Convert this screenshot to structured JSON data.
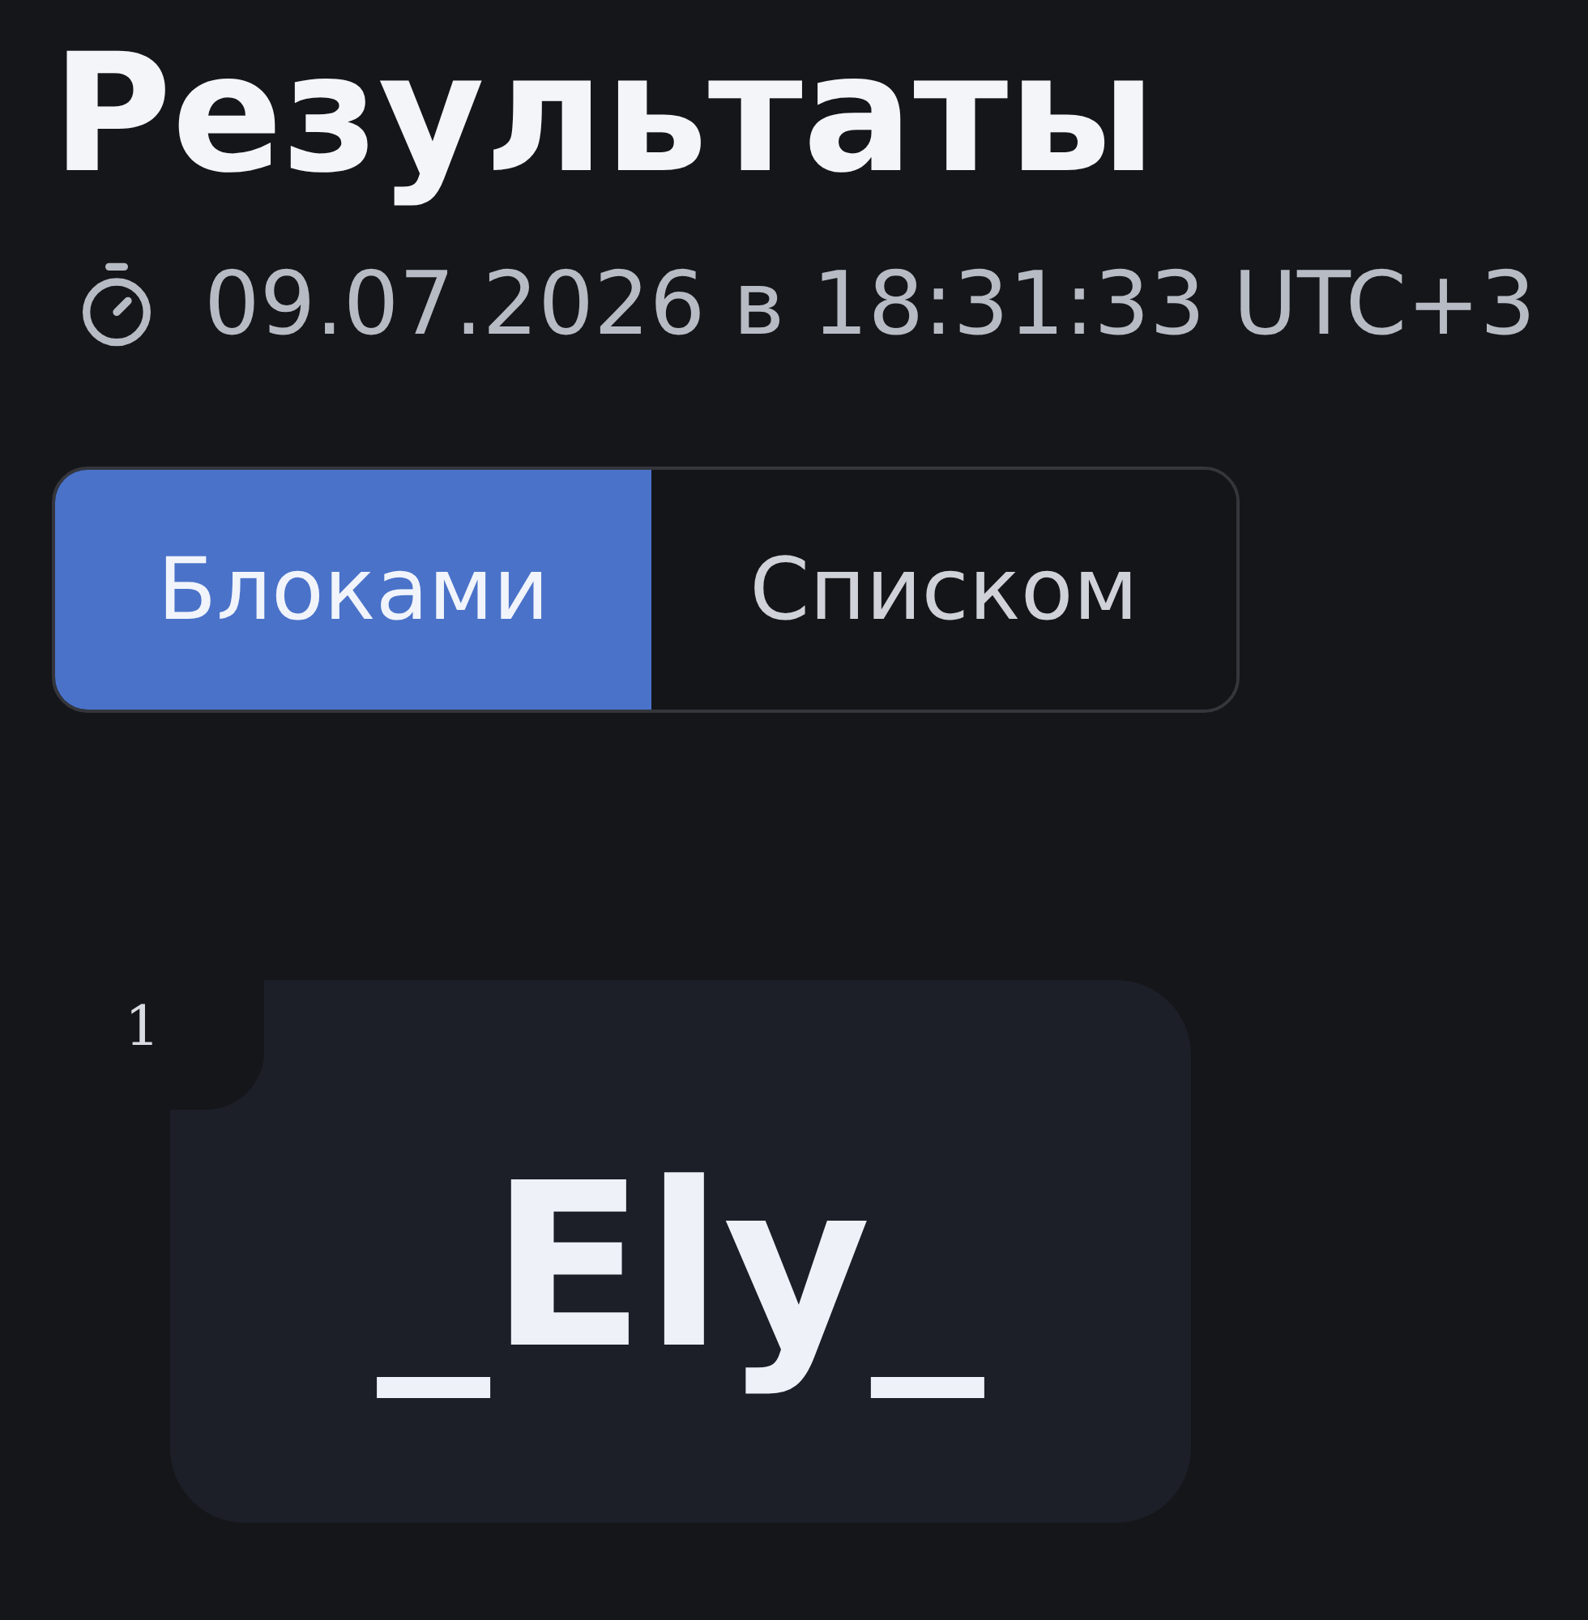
{
  "header": {
    "title": "Результаты",
    "timestamp": "09.07.2026 в 18:31:33 UTC+3"
  },
  "view_tabs": [
    {
      "label": "Блоками",
      "selected": true
    },
    {
      "label": "Списком",
      "selected": false
    }
  ],
  "results": [
    {
      "rank": "1",
      "name": "_Ely_"
    }
  ]
}
